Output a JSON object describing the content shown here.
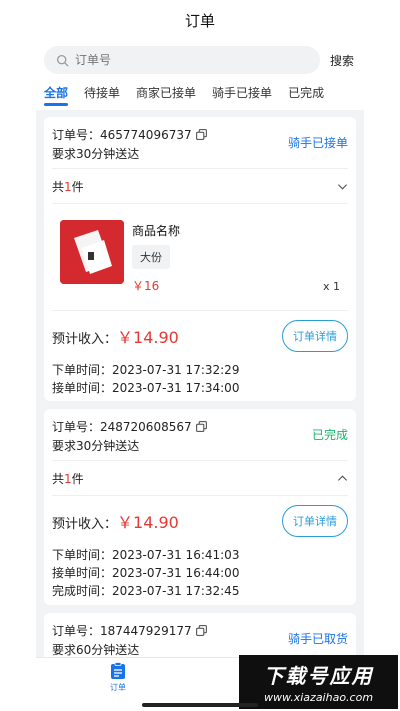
{
  "header": {
    "title": "订单"
  },
  "search": {
    "placeholder": "订单号",
    "button": "搜索"
  },
  "tabs": [
    {
      "label": "全部",
      "active": true
    },
    {
      "label": "待接单"
    },
    {
      "label": "商家已接单"
    },
    {
      "label": "骑手已接单"
    },
    {
      "label": "已完成"
    }
  ],
  "orders": [
    {
      "order_no": "订单号：465774096737",
      "requirement": "要求30分钟送达",
      "status": "骑手已接单",
      "count_prefix": "共",
      "count": "1",
      "count_suffix": "件",
      "product": {
        "name": "商品名称",
        "spec": "大份",
        "price": "￥16",
        "qty": "x 1"
      },
      "income_label": "预计收入：",
      "income": "￥14.90",
      "detail_button": "订单详情",
      "times": [
        "下单时间：2023-07-31 17:32:29",
        "接单时间：2023-07-31 17:34:00"
      ]
    },
    {
      "order_no": "订单号：248720608567",
      "requirement": "要求30分钟送达",
      "status": "已完成",
      "count_prefix": "共",
      "count": "1",
      "count_suffix": "件",
      "income_label": "预计收入：",
      "income": "￥14.90",
      "detail_button": "订单详情",
      "times": [
        "下单时间：2023-07-31 16:41:03",
        "接单时间：2023-07-31 16:44:00",
        "完成时间：2023-07-31 17:32:45"
      ]
    },
    {
      "order_no": "订单号：187447929177",
      "requirement": "要求60分钟送达",
      "status": "骑手已取货"
    }
  ],
  "bottom_nav": {
    "order_label": "订单"
  },
  "watermark": {
    "title": "下载号应用",
    "url": "www.xiazaihao.com"
  },
  "colors": {
    "accent": "#1a73e8",
    "price": "#e53935",
    "done": "#19b36b",
    "outline": "#2a9cd8"
  }
}
